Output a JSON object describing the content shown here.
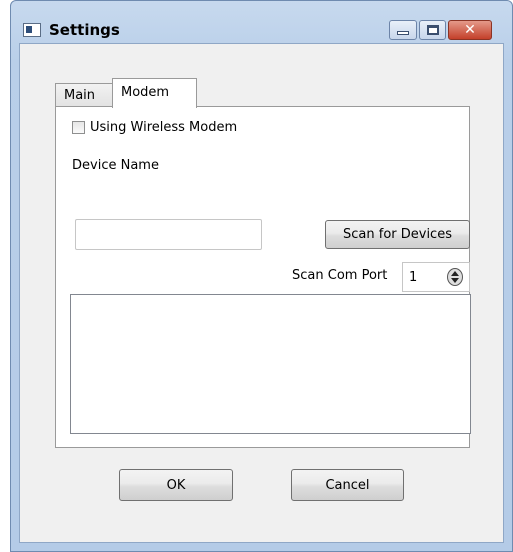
{
  "window": {
    "title": "Settings"
  },
  "tabs": [
    {
      "label": "Main",
      "active": false
    },
    {
      "label": "Modem",
      "active": true
    }
  ],
  "modem": {
    "use_wireless_label": "Using Wireless Modem",
    "use_wireless_checked": false,
    "device_name_label": "Device Name",
    "device_name_value": "",
    "scan_button_label": "Scan for Devices",
    "scan_port_label": "Scan Com Port",
    "scan_port_value": "1"
  },
  "footer": {
    "ok_label": "OK",
    "cancel_label": "Cancel"
  },
  "icons": {
    "app": "window-app-icon",
    "minimize": "minimize-icon",
    "maximize": "maximize-icon",
    "close": "close-icon",
    "spin": "spin-arrows-icon"
  }
}
